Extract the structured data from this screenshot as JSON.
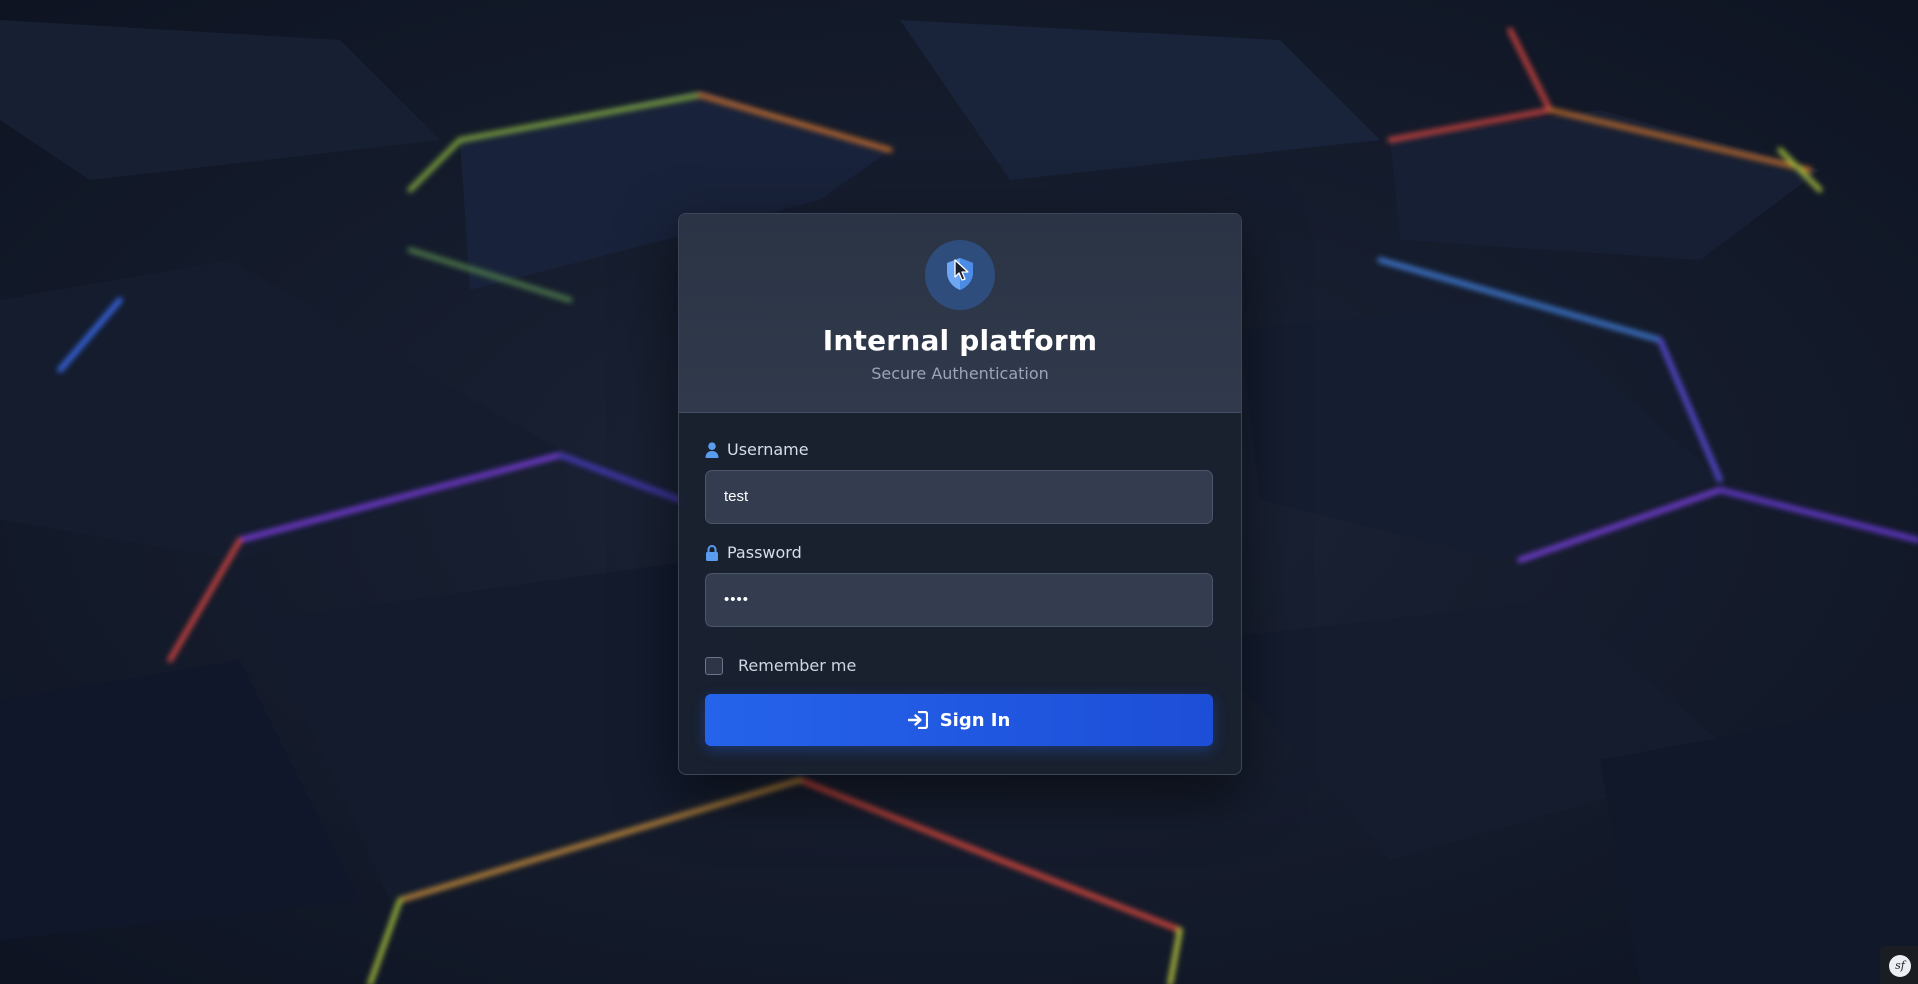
{
  "colors": {
    "accent": "#2563eb",
    "card_background": "#1a2130",
    "input_background": "#343d4f",
    "page_background": "#121a2b"
  },
  "header": {
    "logo_icon": "shield-icon",
    "title": "Internal platform",
    "subtitle": "Secure Authentication"
  },
  "form": {
    "username": {
      "icon": "user-icon",
      "label": "Username",
      "value": "test"
    },
    "password": {
      "icon": "lock-icon",
      "label": "Password",
      "value": "••••"
    },
    "remember": {
      "label": "Remember me",
      "checked": false
    },
    "submit": {
      "icon": "sign-in-icon",
      "label": "Sign In"
    }
  },
  "footer": {
    "badge_icon": "symfony-icon",
    "badge_text": "sf"
  }
}
